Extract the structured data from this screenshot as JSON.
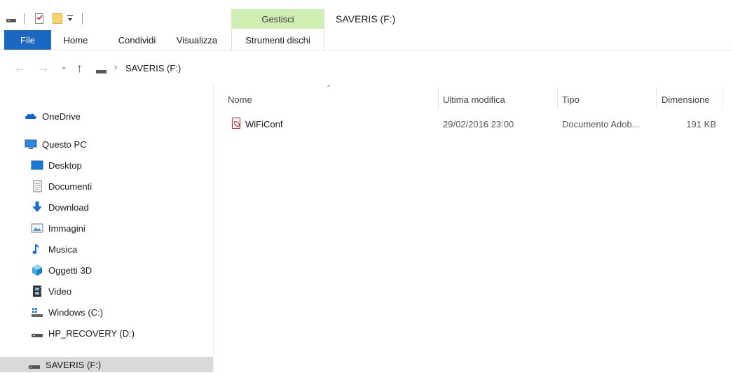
{
  "window": {
    "title": "SAVERIS (F:)",
    "context_group": "Gestisci"
  },
  "ribbon": {
    "tabs": [
      {
        "label": "File",
        "active": true
      },
      {
        "label": "Home"
      },
      {
        "label": "Condividi"
      },
      {
        "label": "Visualizza"
      },
      {
        "label": "Strumenti dischi"
      }
    ]
  },
  "address": {
    "location": "SAVERIS (F:)"
  },
  "nav": {
    "items": [
      {
        "label": "OneDrive",
        "icon": "onedrive-icon"
      },
      {
        "label": "Questo PC",
        "icon": "this-pc-icon"
      },
      {
        "label": "Desktop",
        "icon": "desktop-icon"
      },
      {
        "label": "Documenti",
        "icon": "documents-icon"
      },
      {
        "label": "Download",
        "icon": "download-icon"
      },
      {
        "label": "Immagini",
        "icon": "pictures-icon"
      },
      {
        "label": "Musica",
        "icon": "music-icon"
      },
      {
        "label": "Oggetti 3D",
        "icon": "objects-3d-icon"
      },
      {
        "label": "Video",
        "icon": "video-icon"
      },
      {
        "label": "Windows (C:)",
        "icon": "windows-drive-icon"
      },
      {
        "label": "HP_RECOVERY (D:)",
        "icon": "drive-icon"
      },
      {
        "label": "SAVERIS (F:)",
        "icon": "drive-icon",
        "selected": true
      }
    ]
  },
  "columns": {
    "name": "Nome",
    "modified": "Ultima modifica",
    "type": "Tipo",
    "size": "Dimensione"
  },
  "files": [
    {
      "name": "WiFiConf",
      "modified": "29/02/2016 23:00",
      "type": "Documento Adob...",
      "size": "191 KB",
      "icon": "pdf-icon"
    }
  ],
  "colors": {
    "file_tab": "#1a68c2",
    "context_header": "#cfeeb3",
    "selection": "#d9d9d9"
  }
}
